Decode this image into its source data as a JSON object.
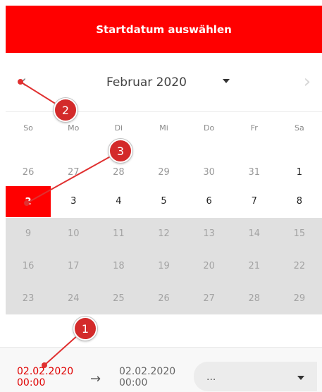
{
  "header": {
    "title": "Startdatum auswählen"
  },
  "nav": {
    "prev_icon": "chevron-left-icon",
    "next_icon": "chevron-right-icon",
    "month": "Februar 2020"
  },
  "weekdays": [
    "So",
    "Mo",
    "Di",
    "Mi",
    "Do",
    "Fr",
    "Sa"
  ],
  "weeks": [
    [
      {
        "d": "26",
        "s": "other"
      },
      {
        "d": "27",
        "s": "other"
      },
      {
        "d": "28",
        "s": "other"
      },
      {
        "d": "29",
        "s": "other"
      },
      {
        "d": "30",
        "s": "other"
      },
      {
        "d": "31",
        "s": "other"
      },
      {
        "d": "1",
        "s": "normal"
      }
    ],
    [
      {
        "d": "2",
        "s": "selected"
      },
      {
        "d": "3",
        "s": "normal"
      },
      {
        "d": "4",
        "s": "normal"
      },
      {
        "d": "5",
        "s": "normal"
      },
      {
        "d": "6",
        "s": "normal"
      },
      {
        "d": "7",
        "s": "normal"
      },
      {
        "d": "8",
        "s": "normal"
      }
    ],
    [
      {
        "d": "9",
        "s": "disabled"
      },
      {
        "d": "10",
        "s": "disabled"
      },
      {
        "d": "11",
        "s": "disabled"
      },
      {
        "d": "12",
        "s": "disabled"
      },
      {
        "d": "13",
        "s": "disabled"
      },
      {
        "d": "14",
        "s": "disabled"
      },
      {
        "d": "15",
        "s": "disabled"
      }
    ],
    [
      {
        "d": "16",
        "s": "disabled"
      },
      {
        "d": "17",
        "s": "disabled"
      },
      {
        "d": "18",
        "s": "disabled"
      },
      {
        "d": "19",
        "s": "disabled"
      },
      {
        "d": "20",
        "s": "disabled"
      },
      {
        "d": "21",
        "s": "disabled"
      },
      {
        "d": "22",
        "s": "disabled"
      }
    ],
    [
      {
        "d": "23",
        "s": "disabled"
      },
      {
        "d": "24",
        "s": "disabled"
      },
      {
        "d": "25",
        "s": "disabled"
      },
      {
        "d": "26",
        "s": "disabled"
      },
      {
        "d": "27",
        "s": "disabled"
      },
      {
        "d": "28",
        "s": "disabled"
      },
      {
        "d": "29",
        "s": "disabled"
      }
    ]
  ],
  "footer": {
    "start": {
      "date": "02.02.2020",
      "time": "00:00"
    },
    "end": {
      "date": "02.02.2020",
      "time": "00:00"
    },
    "arrow": "→",
    "select_value": "..."
  },
  "annotations": [
    "1",
    "2",
    "3"
  ],
  "colors": {
    "accent": "#ff0000",
    "marker": "#d32a2a",
    "disabled_bg": "#e0e0e0"
  }
}
